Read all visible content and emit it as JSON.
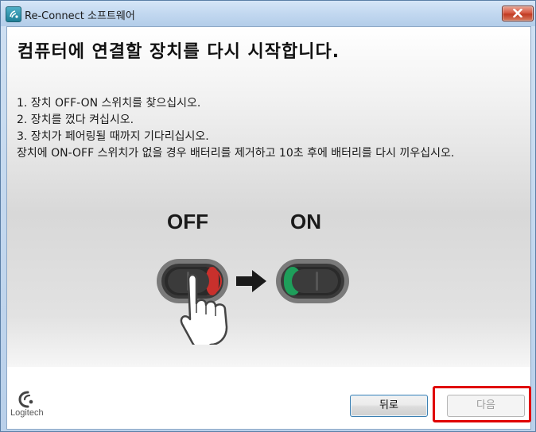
{
  "window": {
    "title": "Re-Connect 소프트웨어"
  },
  "content": {
    "heading": "컴퓨터에 연결할 장치를 다시 시작합니다.",
    "steps": [
      "1. 장치 OFF-ON 스위치를 찾으십시오.",
      "2. 장치를 껐다 켜십시오.",
      "3. 장치가 페어링될 때까지 기다리십시오."
    ],
    "note": "장치에 ON-OFF 스위치가 없을 경우 배터리를 제거하고 10초 후에 배터리를 다시 끼우십시오.",
    "illustration": {
      "off_label": "OFF",
      "on_label": "ON"
    }
  },
  "footer": {
    "logo_text": "Logitech",
    "back_label": "뒤로",
    "next_label": "다음",
    "next_enabled": false
  },
  "colors": {
    "highlight": "#e00000",
    "switch_red": "#d0312d",
    "switch_green": "#1e9e5a"
  }
}
